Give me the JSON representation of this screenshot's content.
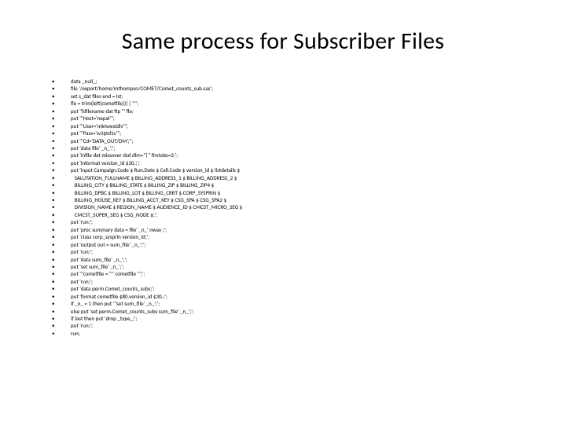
{
  "title": "Same process for Subscriber Files",
  "bullet": "•",
  "lines": [
    "data _null_;",
    "file '/export/home/mthompso/COMET/Comet_counts_sub.sas';",
    "set s_dat files end = lst;",
    "fle = trim(left(cometfile))|| '\"';",
    "put '%filename dat ftp \"' fle;",
    "put '\"Host='nepal'\";",
    "put '\"User='mktwestdiv'\";",
    "put '\"Pass='w3$td1v'\";",
    "put '\"Cd='DATA_OUT/DM';\";",
    "put 'data file' _n_';';",
    "put 'infile dat missover dsd dlm=\"|\" firstobs=2;';",
    "put 'informat version_id $30.;';",
    "put 'input Campaign.Code $ Run.Date $ Cell.Code $ version_id $ listdetails $",
    "   SALUTATION_FULLNAME $ BILLING_ADDRESS_1 $ BILLING_ADDRESS_2 $",
    "   BILLING_CITY $ BILLING_STATE $ BILLING_ZIP $ BILLING_ZIP4 $",
    "   BILLING_DPBC $ BILLING_LOT $ BILLING_CRRT $ CORP_SYSPRIN $",
    "   BILLING_HOUSE_KEY $ BILLING_ACCT_KEY $ CSG_SPA $ CSG_SPA2 $",
    "   DIVISION_NAME $ REGION_NAME $ AUDIENCE_ID $ CMCST_MICRO_SEG $",
    "   CMCST_SUPER_SEG $ CSG_NODE $;';",
    "put 'run;';",
    "put 'proc summary data = file' _n_' nway ;';",
    "put 'class corp_sysprin version_id;';",
    "put 'output out = sum_file' _n_';';",
    "put 'run;';",
    "put 'data sum_file' _n_';';",
    "put 'set sum_file' _n_';';",
    "put '\"cometfile = \"'' cometfile '\";';",
    "put 'run;';",
    "put 'data perm.Comet_counts_subs;';",
    "put 'format cometfile $80.version_id $30.;';",
    "if _n_ = 1 then put '\"set sum_file' _n_';';",
    "else put 'set perm.Comet_counts_subs sum_file' _n_';';",
    "if last then put 'drop _type_;';",
    "put 'run;';",
    "run;"
  ]
}
